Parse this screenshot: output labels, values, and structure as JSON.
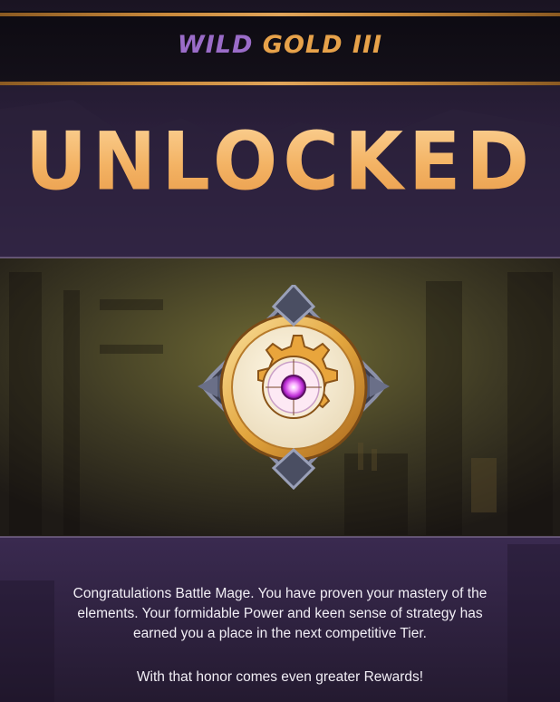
{
  "header": {
    "tier_word1": "WILD",
    "tier_word2": "GOLD III"
  },
  "hero": {
    "title": "UNLOCKED"
  },
  "emblem": {
    "icon": "gold-tier-gear-emblem-icon"
  },
  "message": {
    "paragraph": "Congratulations Battle Mage. You have proven your mastery of the elements. Your formidable Power and keen sense of strategy has earned you a place in the next competitive Tier.",
    "footer": "With that honor comes even greater Rewards!"
  },
  "colors": {
    "wild": "#9a6cc8",
    "gold": "#e7a24a",
    "heading": "#f3b263",
    "background": "#1b1424"
  }
}
